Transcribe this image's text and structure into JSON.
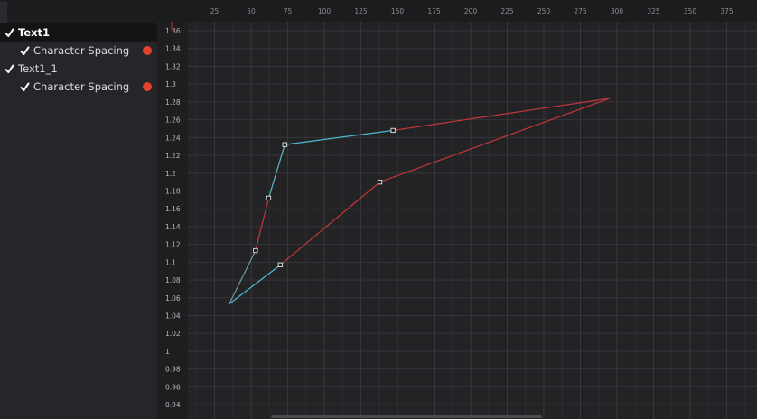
{
  "tree": {
    "items": [
      {
        "label": "Text1",
        "checked": true,
        "selected": true,
        "level": 0,
        "keyframed": false
      },
      {
        "label": "Character Spacing",
        "checked": true,
        "selected": false,
        "level": 1,
        "keyframed": true
      },
      {
        "label": "Text1_1",
        "checked": true,
        "selected": false,
        "level": 0,
        "keyframed": false
      },
      {
        "label": "Character Spacing",
        "checked": true,
        "selected": false,
        "level": 1,
        "keyframed": true
      }
    ]
  },
  "colors": {
    "curve_red": "#c2373a",
    "curve_cyan": "#49b6c7",
    "keyframe_dot": "#e5412d"
  },
  "graph": {
    "x_ticks": [
      25,
      50,
      75,
      100,
      125,
      150,
      175,
      200,
      225,
      250,
      275,
      300,
      325,
      350,
      375
    ],
    "y_ticks": [
      "1.36",
      "1.34",
      "1.32",
      "1.3",
      "1.28",
      "1.26",
      "1.24",
      "1.22",
      "1.2",
      "1.18",
      "1.16",
      "1.14",
      "1.12",
      "1.1",
      "1.08",
      "1.06",
      "1.04",
      "1.02",
      "1",
      "0.98",
      "0.96",
      "0.94"
    ],
    "curves": [
      {
        "name": "",
        "color_key": "curve_red",
        "points": [
          [
            35,
            1.053
          ],
          [
            53,
            1.113
          ],
          [
            62,
            1.172
          ],
          [
            73,
            1.232
          ],
          [
            147,
            1.248
          ],
          [
            295,
            1.284
          ],
          [
            138,
            1.19
          ],
          [
            70,
            1.097
          ],
          [
            35,
            1.053
          ]
        ]
      }
    ]
  }
}
